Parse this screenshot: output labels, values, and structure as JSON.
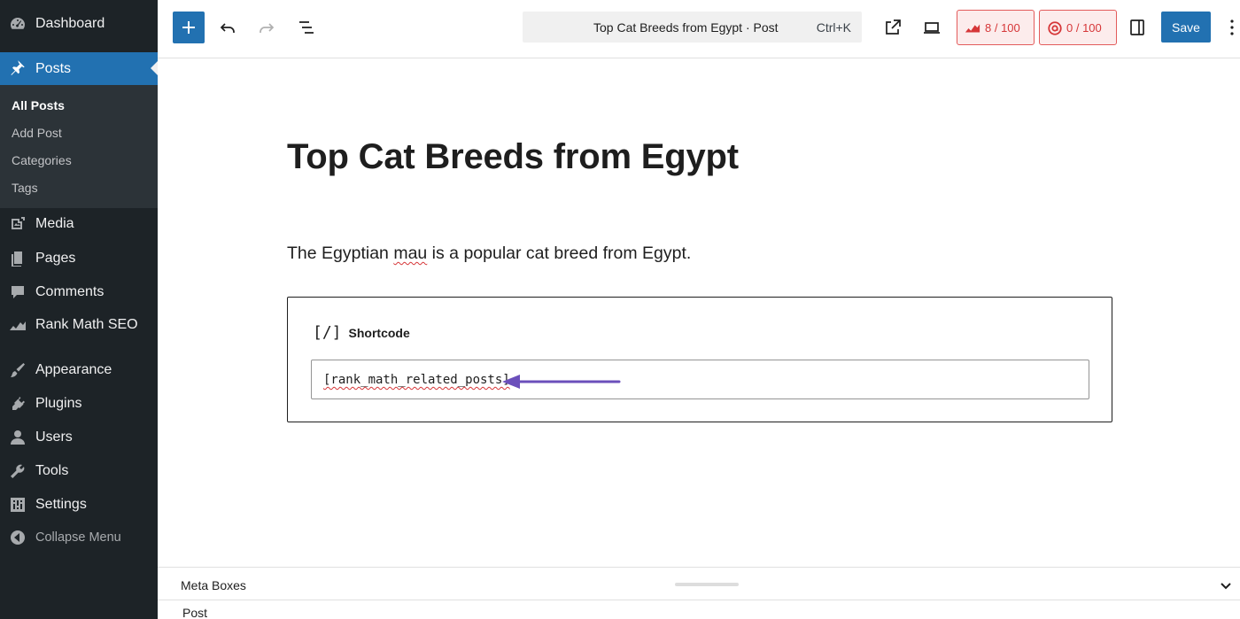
{
  "sidebar": {
    "items": [
      {
        "label": "Dashboard",
        "icon": "dashboard-icon"
      },
      {
        "label": "Posts",
        "icon": "pin-icon"
      },
      {
        "label": "Media",
        "icon": "media-icon"
      },
      {
        "label": "Pages",
        "icon": "pages-icon"
      },
      {
        "label": "Comments",
        "icon": "comments-icon"
      },
      {
        "label": "Rank Math SEO",
        "icon": "rank-math-icon"
      },
      {
        "label": "Appearance",
        "icon": "brush-icon"
      },
      {
        "label": "Plugins",
        "icon": "plugin-icon"
      },
      {
        "label": "Users",
        "icon": "users-icon"
      },
      {
        "label": "Tools",
        "icon": "wrench-icon"
      },
      {
        "label": "Settings",
        "icon": "settings-icon"
      },
      {
        "label": "Collapse Menu",
        "icon": "collapse-icon"
      }
    ],
    "submenu": [
      "All Posts",
      "Add Post",
      "Categories",
      "Tags"
    ]
  },
  "toolbar": {
    "command_title": "Top Cat Breeds from Egypt · Post",
    "command_shortcut": "Ctrl+K",
    "seo_score": "8 / 100",
    "readability_score": "0 / 100",
    "save_label": "Save"
  },
  "editor": {
    "title": "Top Cat Breeds from Egypt",
    "paragraph_before": "The Egyptian ",
    "paragraph_misspelled": "mau",
    "paragraph_after": " is a popular cat breed from Egypt.",
    "shortcode_icon": "[/]",
    "shortcode_label": "Shortcode",
    "shortcode_value": "[rank_math_related_posts]"
  },
  "meta": {
    "title": "Meta Boxes",
    "post_label": "Post"
  },
  "colors": {
    "sidebar_bg": "#1d2327",
    "accent": "#2271b1",
    "score_red": "#d63638",
    "arrow": "#6b4fbb"
  }
}
